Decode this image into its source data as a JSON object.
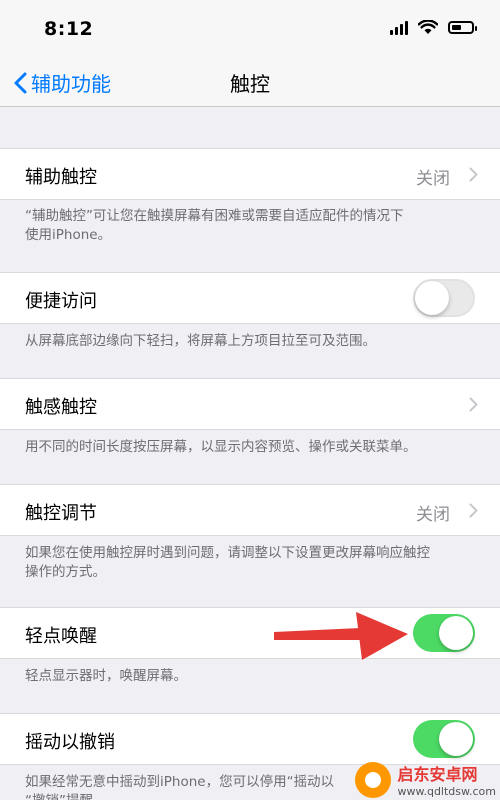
{
  "status_bar": {
    "time": "8:12"
  },
  "nav": {
    "back_label": "辅助功能",
    "title": "触控"
  },
  "rows": {
    "assistive_touch": {
      "label": "辅助触控",
      "value": "关闭"
    },
    "reachability": {
      "label": "便捷访问",
      "toggle": "off"
    },
    "haptic_touch": {
      "label": "触感触控"
    },
    "touch_accommodations": {
      "label": "触控调节",
      "value": "关闭"
    },
    "tap_to_wake": {
      "label": "轻点唤醒",
      "toggle": "on"
    },
    "shake_to_undo": {
      "label": "摇动以撤销",
      "toggle": "on"
    }
  },
  "notes": {
    "assistive_touch_1": "“辅助触控”可让您在触摸屏幕有困难或需要自适应配件的情况下",
    "assistive_touch_2": "使用iPhone。",
    "reachability": "从屏幕底部边缘向下轻扫，将屏幕上方项目拉至可及范围。",
    "haptic_touch": "用不同的时间长度按压屏幕，以显示内容预览、操作或关联菜单。",
    "touch_accommodations_1": "如果您在使用触控屏时遇到问题，请调整以下设置更改屏幕响应触控",
    "touch_accommodations_2": "操作的方式。",
    "tap_to_wake": "轻点显示器时，唤醒屏幕。",
    "shake_to_undo_1": "如果经常无意中摇动到iPhone，您可以停用“摇动以",
    "shake_to_undo_2": "“撤销”提醒"
  },
  "watermark": {
    "name": "启东安卓网",
    "url": "www.qdltdsw.com"
  },
  "colors": {
    "accent": "#007aff",
    "toggle_on": "#4cd964",
    "arrow": "#e53935",
    "background": "#efeff4"
  },
  "icons": [
    "chevron-left-icon",
    "chevron-right-icon",
    "signal-icon",
    "wifi-icon",
    "battery-icon",
    "arrow-icon"
  ]
}
